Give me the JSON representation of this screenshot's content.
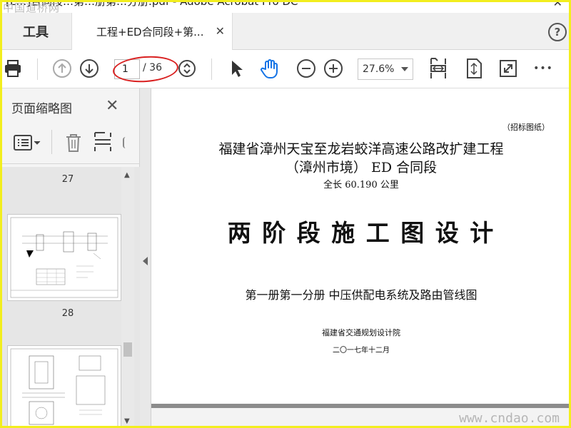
{
  "window": {
    "title": "[L…]合同段…第…册第…分册.pdf - Adobe Acrobat Pro DC",
    "watermark_top": "中国道桥网"
  },
  "tabs": {
    "tools_label": "工具",
    "doc_tab_label": "工程+ED合同段+第...",
    "close_glyph": "✕",
    "help_glyph": "?"
  },
  "toolbar": {
    "page_current": "1",
    "page_total": "/ 36",
    "zoom": "27.6%",
    "more_glyph": "•••"
  },
  "sidebar": {
    "title": "页面缩略图",
    "close_glyph": "✕",
    "page_labels": [
      "27",
      "28"
    ]
  },
  "document": {
    "tag": "（招标图纸）",
    "project_line1": "福建省漳州天宝至龙岩蛟洋高速公路改扩建工程",
    "project_line2": "（漳州市境）  ED 合同段",
    "length": "全长 60.190 公里",
    "main_title": "两 阶 段 施 工 图 设 计",
    "volume": "第一册第一分册  中压供配电系统及路由管线图",
    "institute": "福建省交通规划设计院",
    "date": "二〇一七年十二月"
  },
  "watermark_bottom": "www.cndao.com",
  "colors": {
    "frame": "#f2ee1e",
    "annotation": "#d92020",
    "hand_active": "#1473e6"
  }
}
